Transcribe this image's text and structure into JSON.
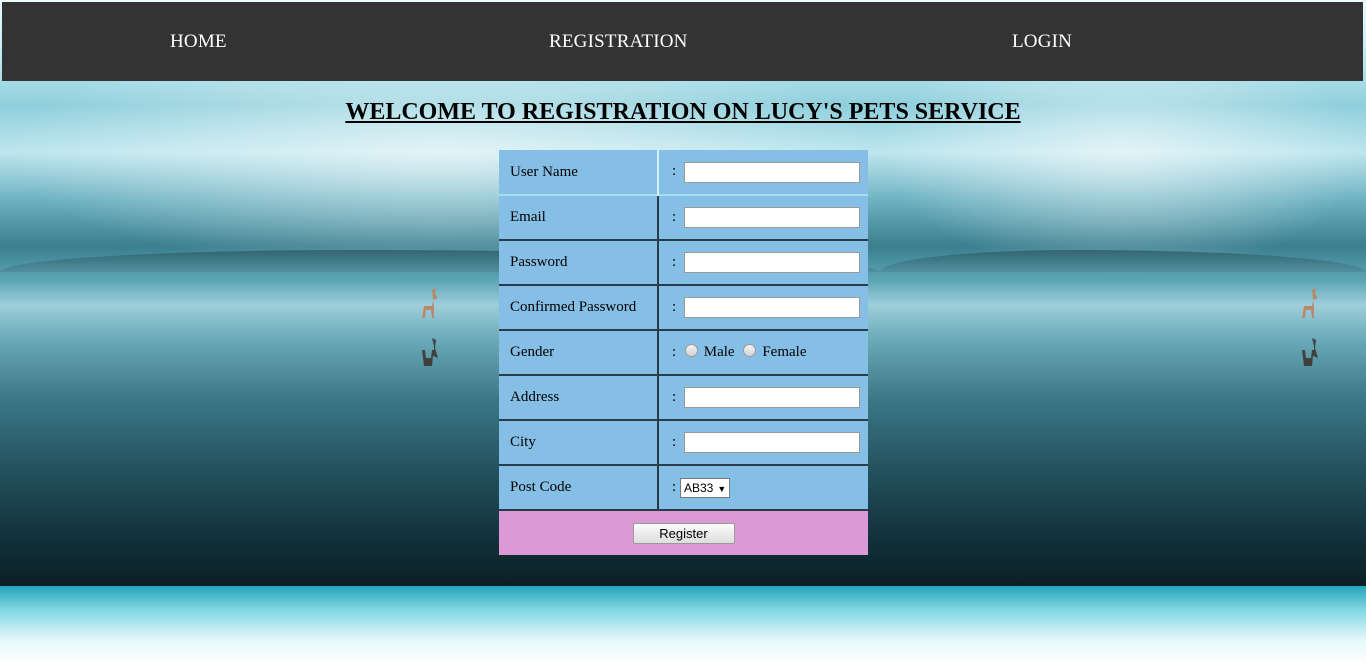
{
  "nav": {
    "home": "HOME",
    "registration": "REGISTRATION",
    "login": "LOGIN"
  },
  "page": {
    "title": "WELCOME TO REGISTRATION ON LUCY'S PETS SERVICE"
  },
  "form": {
    "separator": ":",
    "username": {
      "label": "User Name",
      "value": ""
    },
    "email": {
      "label": "Email",
      "value": ""
    },
    "password": {
      "label": "Password",
      "value": ""
    },
    "confirm_password": {
      "label": "Confirmed Password",
      "value": ""
    },
    "gender": {
      "label": "Gender",
      "options": [
        "Male",
        "Female"
      ]
    },
    "address": {
      "label": "Address",
      "value": ""
    },
    "city": {
      "label": "City",
      "value": ""
    },
    "postcode": {
      "label": "Post Code",
      "selected": "AB33"
    },
    "submit_label": "Register"
  },
  "colors": {
    "nav_background": "#333333",
    "form_cell": "#86bfe6",
    "submit_row": "#dc99d8"
  }
}
